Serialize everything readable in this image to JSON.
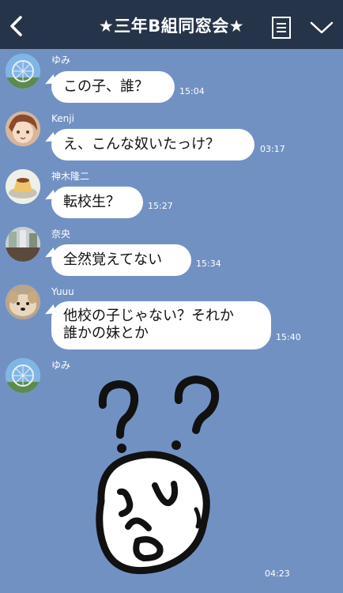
{
  "header": {
    "title": "★三年B組同窓会★",
    "back_icon": "chevron-left-icon",
    "menu_icon": "note-list-icon",
    "dropdown_icon": "chevron-down-icon"
  },
  "messages": [
    {
      "sender": "ゆみ",
      "text": "この子、誰？",
      "time": "15:04",
      "avatar": "ferris-wheel"
    },
    {
      "sender": "Kenji",
      "text": "え、こんな奴いたっけ？",
      "time": "03:17",
      "avatar": "anime-girl"
    },
    {
      "sender": "神木隆二",
      "text": "転校生？",
      "time": "15:27",
      "avatar": "pudding"
    },
    {
      "sender": "奈央",
      "text": "全然覚えてない",
      "time": "15:34",
      "avatar": "cafe"
    },
    {
      "sender": "Yuuu",
      "text_line1": "他校の子じゃない？それか",
      "text_line2": "誰かの妹とか",
      "time": "15:40",
      "avatar": "dog"
    },
    {
      "sender": "ゆみ",
      "sticker": "confused-face-question-marks",
      "time": "04:23",
      "avatar": "ferris-wheel"
    }
  ],
  "colors": {
    "background": "#7291c3",
    "header": "#263449",
    "bubble": "#ffffff"
  }
}
